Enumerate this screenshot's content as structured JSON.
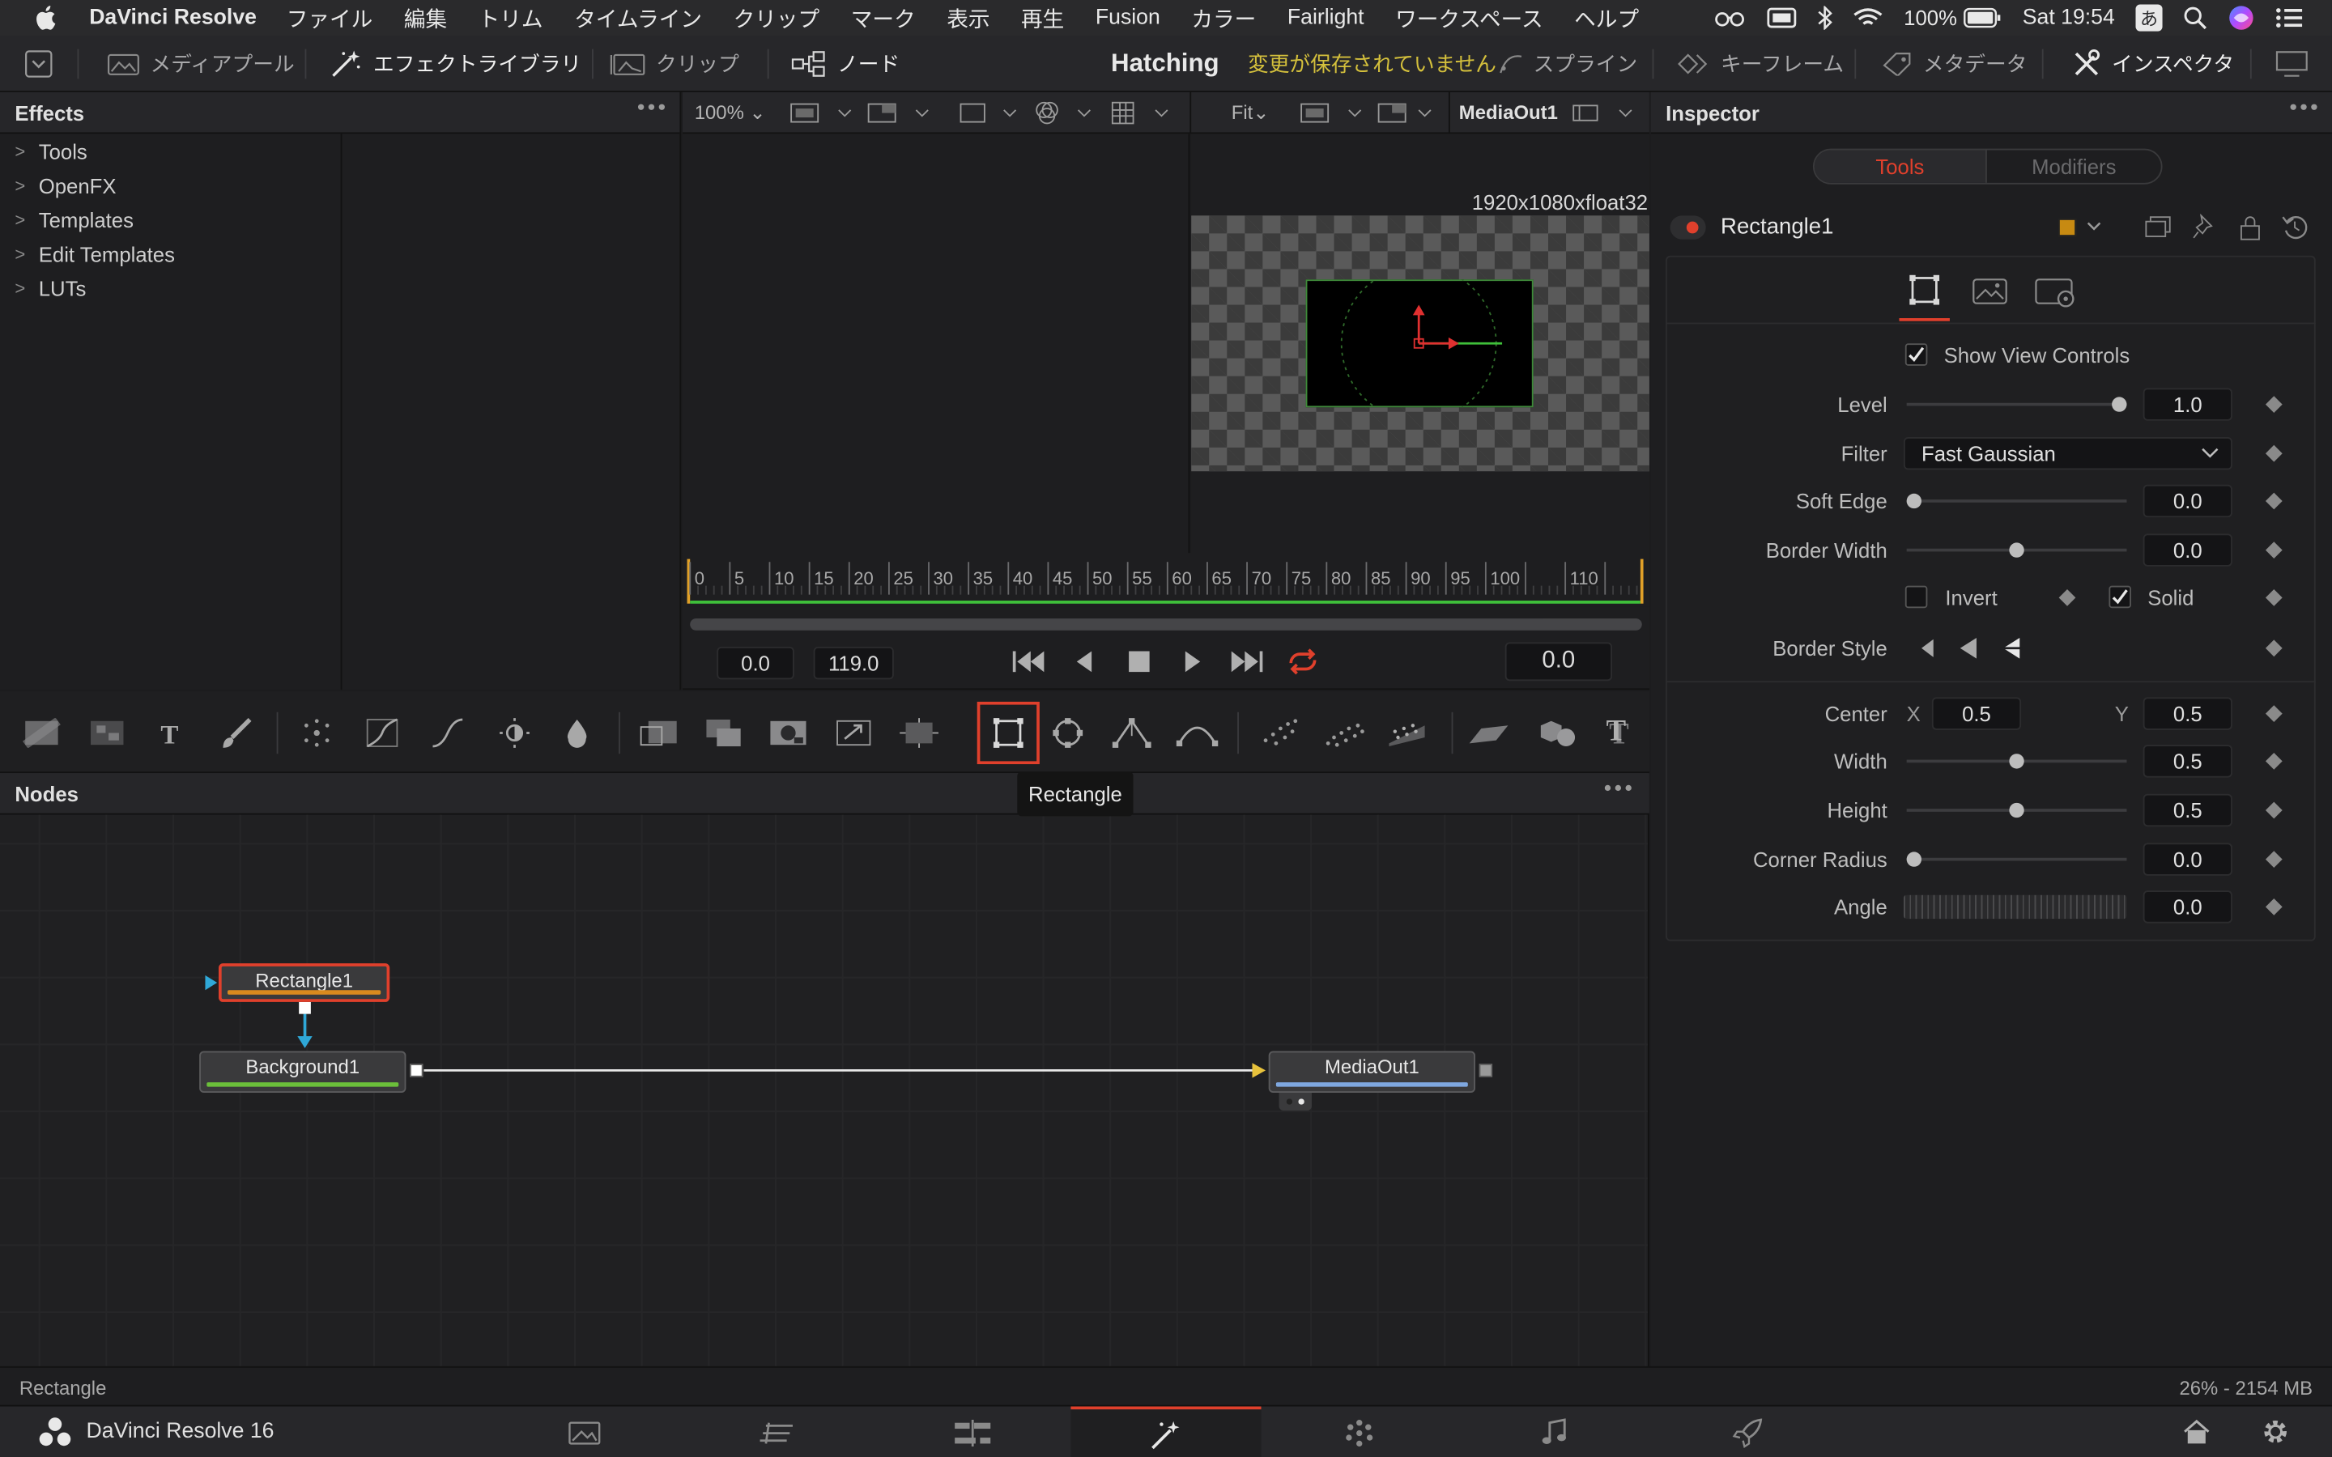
{
  "menubar": {
    "app_name": "DaVinci Resolve",
    "items": [
      "ファイル",
      "編集",
      "トリム",
      "タイムライン",
      "クリップ",
      "マーク",
      "表示",
      "再生",
      "Fusion",
      "カラー",
      "Fairlight",
      "ワークスペース",
      "ヘルプ"
    ],
    "battery": "100%",
    "clock": "Sat 19:54",
    "input_method": "あ"
  },
  "toolbar": {
    "media_pool": "メディアプール",
    "effects_library": "エフェクトライブラリ",
    "clip": "クリップ",
    "nodes": "ノード",
    "project_title": "Hatching",
    "unsaved": "変更が保存されていません",
    "spline": "スプライン",
    "keyframes": "キーフレーム",
    "metadata": "メタデータ",
    "inspector": "インスペクタ"
  },
  "effects": {
    "title": "Effects",
    "tree": [
      "Tools",
      "OpenFX",
      "Templates",
      "Edit Templates",
      "LUTs"
    ]
  },
  "viewer": {
    "zoom_left": "100%",
    "zoom_right": "Fit",
    "output_name": "MediaOut1",
    "resolution": "1920x1080xfloat32"
  },
  "timeline": {
    "ticks": [
      "0",
      "5",
      "10",
      "15",
      "20",
      "25",
      "30",
      "35",
      "40",
      "45",
      "50",
      "55",
      "60",
      "65",
      "70",
      "75",
      "80",
      "85",
      "90",
      "95",
      "100",
      "110"
    ],
    "start": "0.0",
    "end": "119.0",
    "current": "0.0"
  },
  "toolstrip": {
    "tooltip": "Rectangle",
    "selected_tool": "rectangle"
  },
  "nodes": {
    "title": "Nodes",
    "rectangle": "Rectangle1",
    "background": "Background1",
    "mediaout": "MediaOut1"
  },
  "inspector": {
    "title": "Inspector",
    "tab_tools": "Tools",
    "tab_modifiers": "Modifiers",
    "node_name": "Rectangle1",
    "show_view_controls": "Show View Controls",
    "params": {
      "level_label": "Level",
      "level_value": "1.0",
      "filter_label": "Filter",
      "filter_value": "Fast Gaussian",
      "soft_edge_label": "Soft Edge",
      "soft_edge_value": "0.0",
      "border_width_label": "Border Width",
      "border_width_value": "0.0",
      "invert_label": "Invert",
      "solid_label": "Solid",
      "border_style_label": "Border Style",
      "center_label": "Center",
      "center_x_label": "X",
      "center_x": "0.5",
      "center_y_label": "Y",
      "center_y": "0.5",
      "width_label": "Width",
      "width_value": "0.5",
      "height_label": "Height",
      "height_value": "0.5",
      "corner_radius_label": "Corner Radius",
      "corner_radius_value": "0.0",
      "angle_label": "Angle",
      "angle_value": "0.0"
    }
  },
  "status": {
    "left": "Rectangle",
    "right": "26% - 2154 MB"
  },
  "pagebar": {
    "app_label": "DaVinci Resolve 16",
    "active_page": "fusion"
  },
  "colors": {
    "accent_red": "#e0402c",
    "unsaved_yellow": "#d4c03c",
    "node_orange": "#d98a1e",
    "node_green": "#6bbf3a",
    "node_blue": "#7fa8e0",
    "link_cyan": "#2fa8d8"
  }
}
